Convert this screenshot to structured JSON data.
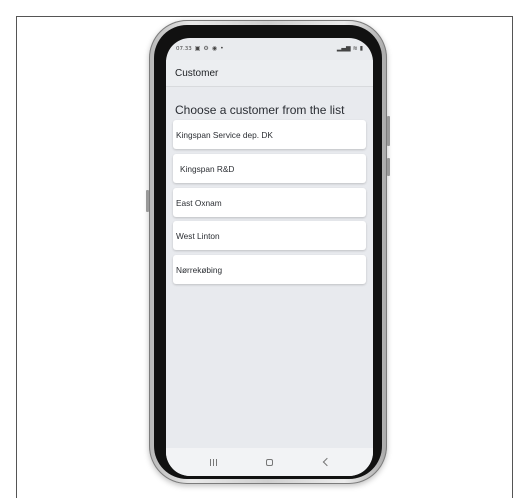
{
  "status_bar": {
    "time": "07.33",
    "right_text": "₄ll 𝟑ᴳ ᵥ₄ll ▮"
  },
  "app_bar": {
    "title": "Customer"
  },
  "content": {
    "prompt": "Choose a customer from the list",
    "customers": [
      {
        "label": "Kingspan Service dep. DK"
      },
      {
        "label": "Kingspan R&D"
      },
      {
        "label": "East Oxnam"
      },
      {
        "label": "West Linton"
      },
      {
        "label": "Nørrekøbing"
      }
    ]
  },
  "icons": {
    "status": [
      "sim-icon",
      "settings-icon",
      "notification-icon",
      "dot-icon"
    ],
    "signal": [
      "signal-icon",
      "wifi-icon",
      "battery-icon"
    ],
    "nav": [
      "recents-icon",
      "home-icon",
      "back-icon"
    ]
  },
  "colors": {
    "screen_background": "#e9ebee",
    "card_background": "#ffffff",
    "text": "#2b2e33"
  }
}
